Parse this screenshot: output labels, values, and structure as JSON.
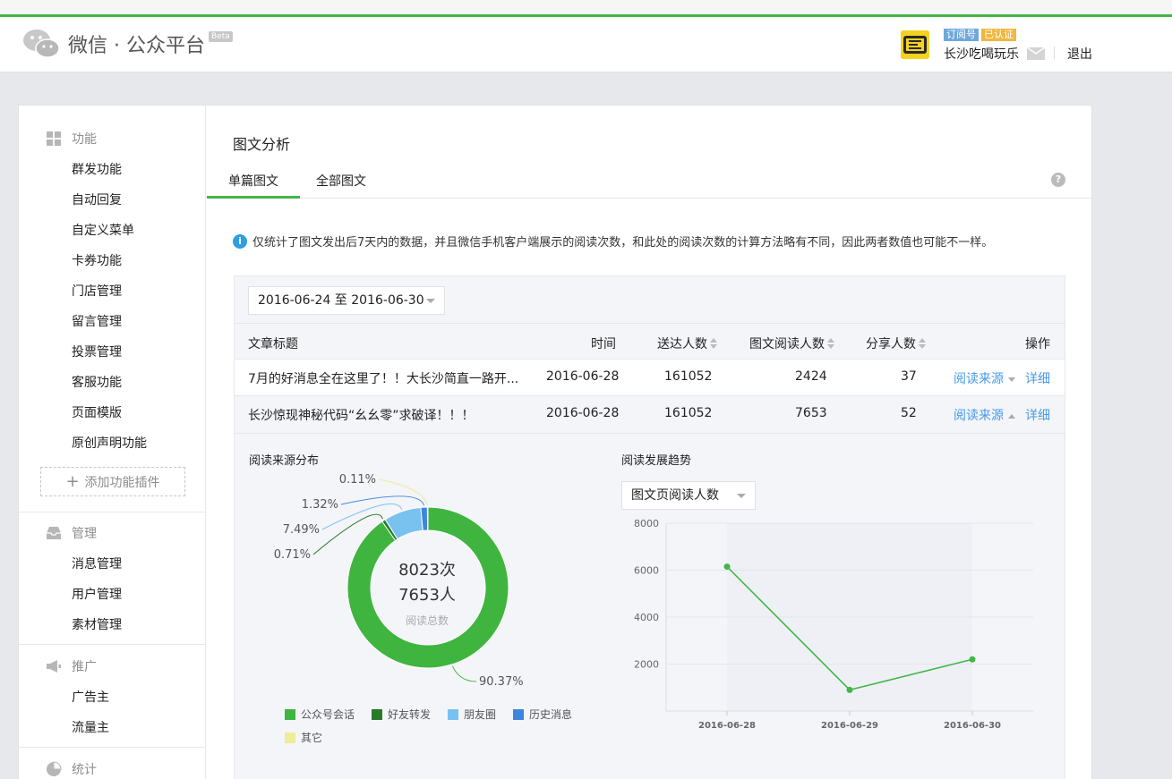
{
  "header": {
    "logo_text": "微信 · 公众平台",
    "beta": "Beta",
    "badge_type": "订阅号",
    "badge_verified": "已认证",
    "account_name": "长沙吃喝玩乐",
    "logout": "退出",
    "brand_color": "#44b549"
  },
  "sidebar": {
    "sections": [
      {
        "title": "功能",
        "icon": "grid-icon",
        "items": [
          "群发功能",
          "自动回复",
          "自定义菜单",
          "卡券功能",
          "门店管理",
          "留言管理",
          "投票管理",
          "客服功能",
          "页面模版",
          "原创声明功能"
        ]
      },
      {
        "title": "管理",
        "icon": "inbox-icon",
        "items": [
          "消息管理",
          "用户管理",
          "素材管理"
        ]
      },
      {
        "title": "推广",
        "icon": "megaphone-icon",
        "items": [
          "广告主",
          "流量主"
        ]
      },
      {
        "title": "统计",
        "icon": "pie-icon",
        "items": []
      }
    ],
    "add_plugin": "添加功能插件"
  },
  "main": {
    "title": "图文分析",
    "tabs": [
      "单篇图文",
      "全部图文"
    ],
    "notice": "仅统计了图文发出后7天内的数据，并且微信手机客户端展示的阅读次数，和此处的阅读次数的计算方法略有不同，因此两者数值也可能不一样。",
    "date_range": "2016-06-24 至 2016-06-30",
    "table": {
      "headers": [
        "文章标题",
        "时间",
        "送达人数",
        "图文阅读人数",
        "分享人数",
        "操作"
      ],
      "rows": [
        {
          "title": "7月的好消息全在这里了！！大长沙简直一路开...",
          "date": "2016-06-28",
          "sent": "161052",
          "reads": "2424",
          "shares": "37",
          "source": "阅读来源",
          "detail": "详细"
        },
        {
          "title": "长沙惊现神秘代码“幺幺零”求破译！！！",
          "date": "2016-06-28",
          "sent": "161052",
          "reads": "7653",
          "shares": "52",
          "source": "阅读来源",
          "detail": "详细"
        }
      ]
    },
    "source_title": "阅读来源分布",
    "trend_title": "阅读发展趋势",
    "metric_select": "图文页阅读人数",
    "donut_center": {
      "line1": "8023次",
      "line2": "7653人",
      "line3": "阅读总数"
    }
  },
  "chart_data": [
    {
      "type": "pie",
      "title": "阅读来源分布",
      "categories": [
        "公众号会话",
        "好友转发",
        "朋友圈",
        "历史消息",
        "其它"
      ],
      "values": [
        90.37,
        0.71,
        7.49,
        1.32,
        0.11
      ],
      "labels": [
        "90.37%",
        "0.71%",
        "7.49%",
        "1.32%",
        "0.11%"
      ],
      "colors": [
        "#3fb53f",
        "#2a7a2a",
        "#79c2f0",
        "#3d85e0",
        "#eeeb99"
      ]
    },
    {
      "type": "line",
      "title": "阅读发展趋势",
      "x": [
        "2016-06-28",
        "2016-06-29",
        "2016-06-30"
      ],
      "y": [
        6150,
        900,
        2200
      ],
      "ylim": [
        0,
        8000
      ],
      "yticks": [
        "2000",
        "4000",
        "6000",
        "8000"
      ],
      "color": "#44b549"
    }
  ]
}
